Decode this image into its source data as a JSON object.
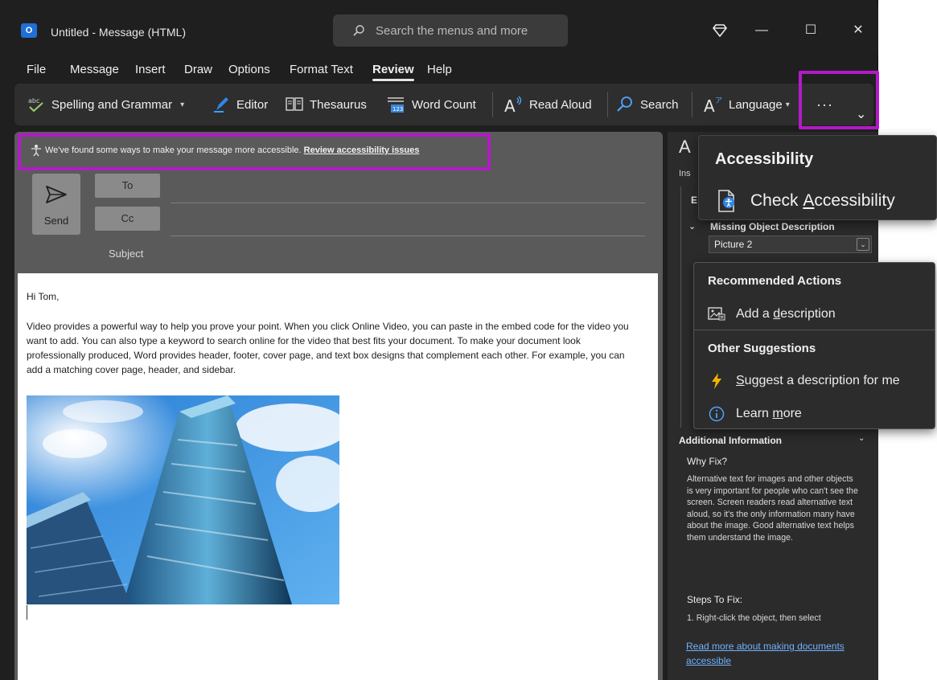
{
  "window": {
    "title": "Untitled  -  Message (HTML)",
    "search_placeholder": "Search the menus and more",
    "controls": {
      "minimize": "—",
      "maximize": "☐",
      "close": "✕"
    }
  },
  "menu": [
    "File",
    "Message",
    "Insert",
    "Draw",
    "Options",
    "Format Text",
    "Review",
    "Help"
  ],
  "menu_active": "Review",
  "ribbon": {
    "spelling": "Spelling and Grammar",
    "editor": "Editor",
    "thesaurus": "Thesaurus",
    "word_count": "Word Count",
    "read_aloud": "Read Aloud",
    "search": "Search",
    "language": "Language",
    "more": "···",
    "expand": "⌄"
  },
  "compose": {
    "infobar_text": "We've found some ways to make your message more accessible.",
    "infobar_link": "Review accessibility issues",
    "send": "Send",
    "to": "To",
    "cc": "Cc",
    "subject": "Subject"
  },
  "body": {
    "greeting": "Hi Tom,",
    "paragraph": "Video provides a powerful way to help you prove your point. When you click Online Video, you can paste in the embed code for the video you want to add. You can also type a keyword to search online for the video that best fits your document. To make your document look professionally produced, Word provides header, footer, cover page, and text box designs that complement each other. For example, you can add a matching cover page, header, and sidebar."
  },
  "side_pane": {
    "title_initial": "A",
    "inspection_initial": "Ins",
    "issue_group_initial": "E",
    "issue_title": "Missing Object Description",
    "issue_object": "Picture 2",
    "additional_info": "Additional Information",
    "why_fix": "Why Fix?",
    "why_body": "Alternative text for images and other objects is very important for people who can't see the screen. Screen readers read alternative text aloud, so it's the only information many have about the image. Good alternative text helps them understand the image.",
    "steps_to_fix": "Steps To Fix:",
    "step1": "1. Right-click the object, then select",
    "read_more": "Read more about making documents accessible"
  },
  "accessibility_flyout": {
    "header": "Accessibility",
    "item_prefix": "Check ",
    "item_accel": "A",
    "item_suffix": "ccessibility"
  },
  "rec_menu": {
    "recommended_header": "Recommended Actions",
    "add_description_prefix": "Add a ",
    "add_description_accel": "d",
    "add_description_suffix": "escription",
    "other_header": "Other Suggestions",
    "suggest_accel": "S",
    "suggest_suffix": "uggest a description for me",
    "learn_prefix": "Learn ",
    "learn_accel": "m",
    "learn_suffix": "ore"
  },
  "colors": {
    "highlight": "#b31bc7",
    "window_bg": "#1f1f1f",
    "link": "#6fb1ff"
  }
}
